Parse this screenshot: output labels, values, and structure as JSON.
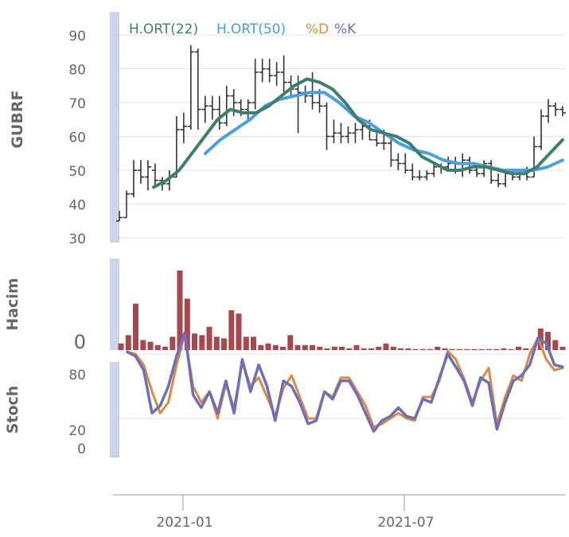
{
  "chart_data": [
    {
      "type": "ohlc",
      "ylabel": "GUBRF",
      "yticks": [
        30,
        40,
        50,
        60,
        70,
        80,
        90
      ],
      "ylim": [
        27,
        95
      ],
      "grid": "horizontal",
      "legend": {
        "placement": "top-left",
        "items": [
          {
            "name": "H.ORT(22)",
            "color": "#3d7f6e"
          },
          {
            "name": "H.ORT(50)",
            "color": "#4a9fe0"
          },
          {
            "name": "%D",
            "color": "#d98c45"
          },
          {
            "name": "%K",
            "color": "#6f6fb8"
          }
        ]
      },
      "bar_color": "#333333",
      "ohlc": [
        {
          "o": 35,
          "h": 38,
          "l": 35,
          "c": 36
        },
        {
          "o": 36,
          "h": 44,
          "l": 36,
          "c": 43
        },
        {
          "o": 43,
          "h": 53,
          "l": 42,
          "c": 50
        },
        {
          "o": 50,
          "h": 53,
          "l": 46,
          "c": 48
        },
        {
          "o": 48,
          "h": 53,
          "l": 44,
          "c": 51
        },
        {
          "o": 50,
          "h": 52,
          "l": 45,
          "c": 47
        },
        {
          "o": 47,
          "h": 48,
          "l": 44,
          "c": 46
        },
        {
          "o": 46,
          "h": 50,
          "l": 44,
          "c": 48
        },
        {
          "o": 48,
          "h": 66,
          "l": 48,
          "c": 62
        },
        {
          "o": 62,
          "h": 67,
          "l": 58,
          "c": 63
        },
        {
          "o": 63,
          "h": 87,
          "l": 62,
          "c": 85
        },
        {
          "o": 85,
          "h": 86,
          "l": 62,
          "c": 68
        },
        {
          "o": 68,
          "h": 72,
          "l": 64,
          "c": 69
        },
        {
          "o": 69,
          "h": 72,
          "l": 65,
          "c": 68
        },
        {
          "o": 68,
          "h": 72,
          "l": 62,
          "c": 64
        },
        {
          "o": 64,
          "h": 75,
          "l": 63,
          "c": 72
        },
        {
          "o": 72,
          "h": 74,
          "l": 66,
          "c": 70
        },
        {
          "o": 70,
          "h": 71,
          "l": 66,
          "c": 68
        },
        {
          "o": 68,
          "h": 71,
          "l": 65,
          "c": 70
        },
        {
          "o": 70,
          "h": 83,
          "l": 68,
          "c": 79
        },
        {
          "o": 79,
          "h": 83,
          "l": 76,
          "c": 80
        },
        {
          "o": 80,
          "h": 83,
          "l": 76,
          "c": 78
        },
        {
          "o": 78,
          "h": 82,
          "l": 75,
          "c": 79
        },
        {
          "o": 79,
          "h": 84,
          "l": 72,
          "c": 76
        },
        {
          "o": 76,
          "h": 78,
          "l": 72,
          "c": 74
        },
        {
          "o": 74,
          "h": 78,
          "l": 61,
          "c": 73
        },
        {
          "o": 73,
          "h": 75,
          "l": 70,
          "c": 72
        },
        {
          "o": 72,
          "h": 79,
          "l": 68,
          "c": 70
        },
        {
          "o": 70,
          "h": 74,
          "l": 67,
          "c": 69
        },
        {
          "o": 69,
          "h": 70,
          "l": 56,
          "c": 60
        },
        {
          "o": 60,
          "h": 65,
          "l": 58,
          "c": 61
        },
        {
          "o": 61,
          "h": 64,
          "l": 58,
          "c": 60
        },
        {
          "o": 60,
          "h": 63,
          "l": 58,
          "c": 61
        },
        {
          "o": 61,
          "h": 64,
          "l": 58,
          "c": 62
        },
        {
          "o": 62,
          "h": 65,
          "l": 59,
          "c": 63
        },
        {
          "o": 63,
          "h": 65,
          "l": 59,
          "c": 59
        },
        {
          "o": 59,
          "h": 61,
          "l": 57,
          "c": 58
        },
        {
          "o": 58,
          "h": 62,
          "l": 56,
          "c": 58
        },
        {
          "o": 58,
          "h": 60,
          "l": 51,
          "c": 53
        },
        {
          "o": 53,
          "h": 55,
          "l": 50,
          "c": 52
        },
        {
          "o": 52,
          "h": 55,
          "l": 49,
          "c": 50
        },
        {
          "o": 50,
          "h": 52,
          "l": 47,
          "c": 48
        },
        {
          "o": 48,
          "h": 50,
          "l": 47,
          "c": 48
        },
        {
          "o": 48,
          "h": 50,
          "l": 47,
          "c": 49
        },
        {
          "o": 49,
          "h": 52,
          "l": 48,
          "c": 51
        },
        {
          "o": 51,
          "h": 52,
          "l": 49,
          "c": 51
        },
        {
          "o": 51,
          "h": 54,
          "l": 50,
          "c": 52
        },
        {
          "o": 52,
          "h": 54,
          "l": 49,
          "c": 50
        },
        {
          "o": 50,
          "h": 55,
          "l": 48,
          "c": 53
        },
        {
          "o": 53,
          "h": 54,
          "l": 49,
          "c": 50
        },
        {
          "o": 50,
          "h": 52,
          "l": 48,
          "c": 49
        },
        {
          "o": 49,
          "h": 53,
          "l": 48,
          "c": 52
        },
        {
          "o": 52,
          "h": 53,
          "l": 46,
          "c": 47
        },
        {
          "o": 47,
          "h": 49,
          "l": 45,
          "c": 46
        },
        {
          "o": 46,
          "h": 50,
          "l": 45,
          "c": 49
        },
        {
          "o": 49,
          "h": 50,
          "l": 47,
          "c": 48
        },
        {
          "o": 48,
          "h": 50,
          "l": 47,
          "c": 49
        },
        {
          "o": 49,
          "h": 51,
          "l": 47,
          "c": 48
        },
        {
          "o": 48,
          "h": 60,
          "l": 48,
          "c": 57
        },
        {
          "o": 57,
          "h": 68,
          "l": 56,
          "c": 66
        },
        {
          "o": 66,
          "h": 71,
          "l": 64,
          "c": 69
        },
        {
          "o": 69,
          "h": 70,
          "l": 66,
          "c": 68
        },
        {
          "o": 68,
          "h": 69,
          "l": 66,
          "c": 67
        }
      ],
      "ma22": [
        45,
        47,
        50,
        55,
        60,
        65,
        68,
        67,
        67,
        69,
        72,
        75,
        77,
        76,
        74,
        70,
        65,
        62,
        61,
        60,
        58,
        54,
        52,
        50,
        50,
        51,
        51,
        50,
        49,
        49,
        51,
        55,
        59
      ],
      "ma50": [
        55,
        59,
        62,
        65,
        69,
        71,
        72,
        73,
        73,
        70,
        66,
        64,
        61,
        58,
        56,
        55,
        53,
        52,
        52,
        51,
        50,
        50,
        50,
        51,
        53
      ]
    },
    {
      "type": "bar",
      "ylabel": "Hacim",
      "yticks": [
        0
      ],
      "color": "#a8474f",
      "values": [
        2,
        4.5,
        14,
        3,
        2.5,
        1.5,
        1,
        4,
        24,
        15.5,
        5,
        4.5,
        7,
        4,
        3.5,
        12,
        11,
        4,
        4,
        1.5,
        2,
        1.5,
        1,
        4.5,
        1.5,
        1.5,
        1.5,
        1,
        0.5,
        1,
        1,
        0.5,
        1.5,
        0.5,
        0.5,
        1,
        2,
        1,
        0.5,
        0.5,
        0.3,
        0.3,
        0.3,
        1,
        0.5,
        0.3,
        0.3,
        0.3,
        0.3,
        0.3,
        0.3,
        0.3,
        0.5,
        0.3,
        1,
        0.5,
        0.5,
        6.5,
        5.5,
        3,
        1
      ]
    },
    {
      "type": "line",
      "ylabel": "Stoch",
      "yticks": [
        0,
        20,
        80
      ],
      "ylim": [
        0,
        100
      ],
      "grid": "horizontal",
      "x_ticks": [
        "2021-01",
        "2021-07"
      ],
      "series": [
        {
          "name": "%D",
          "color": "#d98c45",
          "values": [
            82,
            80,
            70,
            45,
            25,
            35,
            70,
            98,
            50,
            35,
            45,
            20,
            52,
            30,
            72,
            50,
            58,
            40,
            22,
            48,
            60,
            40,
            20,
            20,
            45,
            40,
            58,
            58,
            45,
            32,
            12,
            15,
            20,
            25,
            20,
            18,
            40,
            40,
            55,
            83,
            75,
            57,
            35,
            55,
            67,
            15,
            40,
            60,
            55,
            80,
            95,
            75,
            65,
            67
          ]
        },
        {
          "name": "%K",
          "color": "#6f6fb8",
          "values": [
            82,
            78,
            65,
            25,
            32,
            50,
            78,
            100,
            42,
            30,
            45,
            25,
            55,
            25,
            75,
            45,
            70,
            50,
            18,
            55,
            50,
            35,
            15,
            18,
            45,
            38,
            55,
            55,
            42,
            25,
            8,
            18,
            22,
            30,
            22,
            20,
            38,
            35,
            58,
            80,
            68,
            55,
            32,
            58,
            53,
            10,
            35,
            55,
            60,
            70,
            95,
            90,
            70,
            68
          ]
        }
      ]
    }
  ]
}
